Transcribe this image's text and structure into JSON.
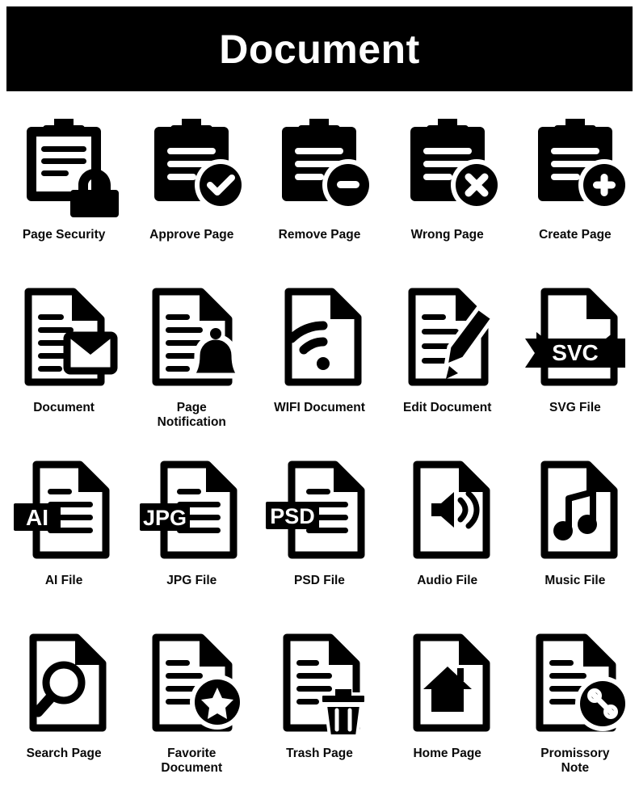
{
  "header": {
    "title": "Document",
    "background_color": "#000000",
    "text_color": "#ffffff"
  },
  "page": {
    "background_color": "#ffffff",
    "icon_color": "#000000",
    "caption_color": "#0a0a0a",
    "columns": 5,
    "rows": 4,
    "total_icons": 20
  },
  "icons": [
    {
      "label": "Page Security",
      "icon": "clipboard-lock-icon"
    },
    {
      "label": "Approve Page",
      "icon": "clipboard-check-icon"
    },
    {
      "label": "Remove Page",
      "icon": "clipboard-minus-icon"
    },
    {
      "label": "Wrong Page",
      "icon": "clipboard-cross-icon"
    },
    {
      "label": "Create Page",
      "icon": "clipboard-plus-icon"
    },
    {
      "label": "Document",
      "icon": "document-envelope-icon"
    },
    {
      "label": "Page\nNotification",
      "icon": "document-bell-icon"
    },
    {
      "label": "WIFI Document",
      "icon": "document-wifi-icon"
    },
    {
      "label": "Edit Document",
      "icon": "document-pen-icon"
    },
    {
      "label": "SVG File",
      "icon": "svg-file-ribbon-icon",
      "badge_text": "SVC"
    },
    {
      "label": "AI File",
      "icon": "ai-file-icon",
      "badge_text": "AI"
    },
    {
      "label": "JPG File",
      "icon": "jpg-file-icon",
      "badge_text": "JPG"
    },
    {
      "label": "PSD File",
      "icon": "psd-file-icon",
      "badge_text": "PSD"
    },
    {
      "label": "Audio File",
      "icon": "audio-file-speaker-icon"
    },
    {
      "label": "Music File",
      "icon": "music-file-note-icon"
    },
    {
      "label": "Search Page",
      "icon": "document-magnifier-icon"
    },
    {
      "label": "Favorite\nDocument",
      "icon": "document-star-icon"
    },
    {
      "label": "Trash Page",
      "icon": "document-trash-icon"
    },
    {
      "label": "Home Page",
      "icon": "document-home-icon"
    },
    {
      "label": "Promissory\nNote",
      "icon": "document-percent-icon"
    }
  ]
}
